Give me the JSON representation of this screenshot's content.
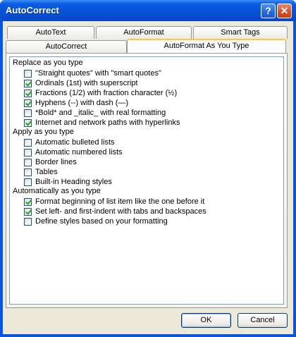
{
  "window": {
    "title": "AutoCorrect",
    "help_glyph": "?",
    "close_glyph": "✕"
  },
  "tabs_row1": [
    {
      "label": "AutoText"
    },
    {
      "label": "AutoFormat"
    },
    {
      "label": "Smart Tags"
    }
  ],
  "tabs_row2": [
    {
      "label": "AutoCorrect"
    },
    {
      "label": "AutoFormat As You Type",
      "selected": true
    }
  ],
  "sections": [
    {
      "heading": "Replace as you type",
      "options": [
        {
          "label": "\"Straight quotes\" with \"smart quotes\"",
          "checked": false
        },
        {
          "label": "Ordinals (1st) with superscript",
          "checked": true
        },
        {
          "label": "Fractions (1/2) with fraction character (½)",
          "checked": true
        },
        {
          "label": "Hyphens (--) with dash (—)",
          "checked": true
        },
        {
          "label": "*Bold* and _italic_ with real formatting",
          "checked": false
        },
        {
          "label": "Internet and network paths with hyperlinks",
          "checked": true
        }
      ]
    },
    {
      "heading": "Apply as you type",
      "options": [
        {
          "label": "Automatic bulleted lists",
          "checked": false
        },
        {
          "label": "Automatic numbered lists",
          "checked": false
        },
        {
          "label": "Border lines",
          "checked": false
        },
        {
          "label": "Tables",
          "checked": false
        },
        {
          "label": "Built-in Heading styles",
          "checked": false
        }
      ]
    },
    {
      "heading": "Automatically as you type",
      "options": [
        {
          "label": "Format beginning of list item like the one before it",
          "checked": true
        },
        {
          "label": "Set left- and first-indent with tabs and backspaces",
          "checked": true
        },
        {
          "label": "Define styles based on your formatting",
          "checked": false
        }
      ]
    }
  ],
  "buttons": {
    "ok": "OK",
    "cancel": "Cancel"
  }
}
